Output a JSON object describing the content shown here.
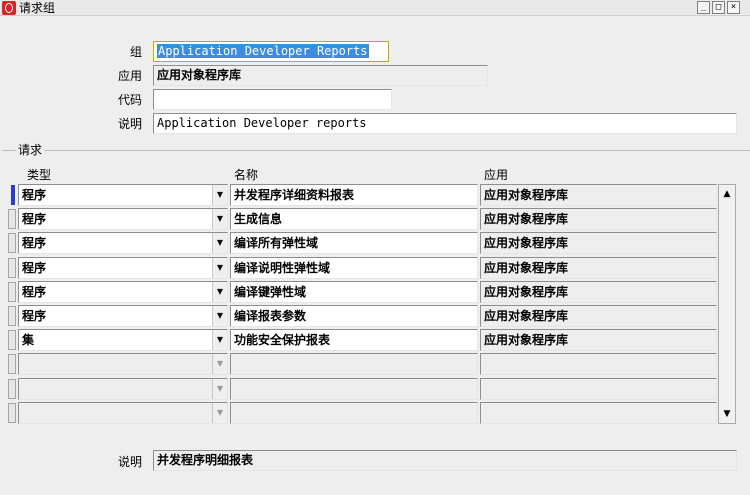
{
  "window": {
    "title": "请求组",
    "minimize_glyph": "_",
    "maximize_glyph": "□",
    "close_glyph": "×"
  },
  "header": {
    "group_label": "组",
    "group_value": "Application Developer Reports",
    "application_label": "应用",
    "application_value": "应用对象程序库",
    "code_label": "代码",
    "code_value": "",
    "description_label": "说明",
    "description_value": "Application Developer reports"
  },
  "requests": {
    "section_label": "请求",
    "columns": {
      "type": "类型",
      "name": "名称",
      "application": "应用"
    },
    "rows": [
      {
        "type": "程序",
        "name": "并发程序详细资料报表",
        "application": "应用对象程序库"
      },
      {
        "type": "程序",
        "name": "生成信息",
        "application": "应用对象程序库"
      },
      {
        "type": "程序",
        "name": "编译所有弹性域",
        "application": "应用对象程序库"
      },
      {
        "type": "程序",
        "name": "编译说明性弹性域",
        "application": "应用对象程序库"
      },
      {
        "type": "程序",
        "name": "编译键弹性域",
        "application": "应用对象程序库"
      },
      {
        "type": "程序",
        "name": "编译报表参数",
        "application": "应用对象程序库"
      },
      {
        "type": "集",
        "name": "功能安全保护报表",
        "application": "应用对象程序库"
      },
      {
        "type": "",
        "name": "",
        "application": ""
      },
      {
        "type": "",
        "name": "",
        "application": ""
      },
      {
        "type": "",
        "name": "",
        "application": ""
      }
    ]
  },
  "footer": {
    "description_label": "说明",
    "description_value": "并发程序明细报表"
  },
  "icons": {
    "dropdown": "▼",
    "scroll_up": "▲",
    "scroll_down": "▼"
  }
}
